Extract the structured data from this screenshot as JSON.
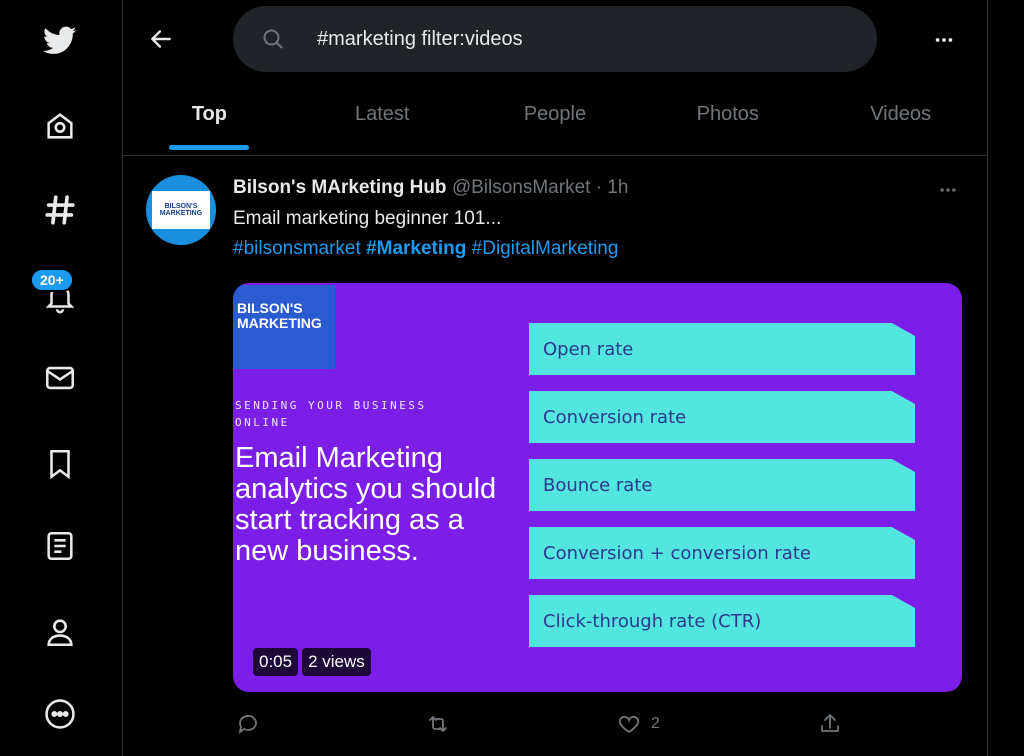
{
  "search": {
    "value": "#marketing filter:videos"
  },
  "sidebar": {
    "notifications_badge": "20+"
  },
  "tabs": [
    {
      "label": "Top"
    },
    {
      "label": "Latest"
    },
    {
      "label": "People"
    },
    {
      "label": "Photos"
    },
    {
      "label": "Videos"
    }
  ],
  "tweet": {
    "name": "Bilson's MArketing Hub",
    "handle": "@BilsonsMarket",
    "time": "· 1h",
    "text": "Email marketing beginner 101...",
    "hashtags": [
      "#bilsonsmarket",
      "#Marketing",
      "#DigitalMarketing"
    ],
    "avatar_text": [
      "BILSON'S",
      "MARKETING"
    ],
    "media": {
      "logo_lines": [
        "BILSON'S",
        "MARKETING"
      ],
      "kicker_lines": [
        "SENDING YOUR BUSINESS",
        "ONLINE"
      ],
      "headline": "Email Marketing analytics you should start tracking as a new business.",
      "list": [
        "Open rate",
        "Conversion rate",
        "Bounce rate",
        "Conversion + conversion rate",
        "Click-through rate (CTR)"
      ],
      "duration": "0:05",
      "views": "2 views"
    },
    "likes": "2"
  },
  "colors": {
    "accent": "#1d9bf0",
    "media_bg": "#7b1fe8",
    "pill": "#53e6e0"
  }
}
